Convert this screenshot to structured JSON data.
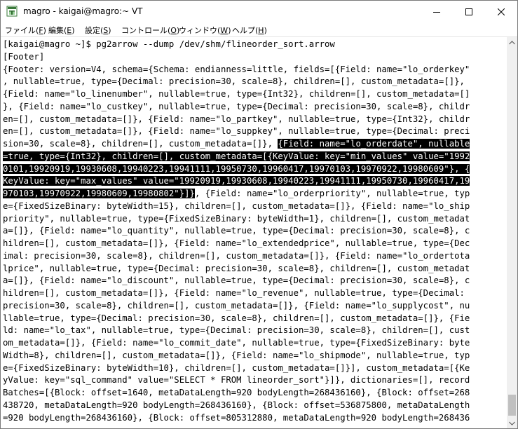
{
  "window": {
    "title": "magro - kaigai@magro:~ VT"
  },
  "menu": [
    {
      "label": "ファイル(",
      "key": "F",
      "end": ")"
    },
    {
      "label": "編集(",
      "key": "E",
      "end": ")"
    },
    {
      "label": "設定(",
      "key": "S",
      "end": ")"
    },
    {
      "label": "コントロール(",
      "key": "O",
      "end": ")"
    },
    {
      "label": "ウィンドウ(",
      "key": "W",
      "end": ")"
    },
    {
      "label": "ヘルプ(",
      "key": "H",
      "end": ")"
    }
  ],
  "terminal": {
    "lines": [
      {
        "a": "[kaigai@magro ~]$ pg2arrow --dump /dev/shm/flineorder_sort.arrow",
        "h": "",
        "b": ""
      },
      {
        "a": "[Footer]",
        "h": "",
        "b": ""
      },
      {
        "a": "{Footer: version=V4, schema={Schema: endianness=little, fields=[{Field: name=\"lo_orderkey\"",
        "h": "",
        "b": ""
      },
      {
        "a": ", nullable=true, type={Decimal: precision=30, scale=8}, children=[], custom_metadata=[]},",
        "h": "",
        "b": ""
      },
      {
        "a": "{Field: name=\"lo_linenumber\", nullable=true, type={Int32}, children=[], custom_metadata=[]",
        "h": "",
        "b": ""
      },
      {
        "a": "}, {Field: name=\"lo_custkey\", nullable=true, type={Decimal: precision=30, scale=8}, childr",
        "h": "",
        "b": ""
      },
      {
        "a": "en=[], custom_metadata=[]}, {Field: name=\"lo_partkey\", nullable=true, type={Int32}, childr",
        "h": "",
        "b": ""
      },
      {
        "a": "en=[], custom_metadata=[]}, {Field: name=\"lo_suppkey\", nullable=true, type={Decimal: preci",
        "h": "",
        "b": ""
      },
      {
        "a": "sion=30, scale=8}, children=[], custom_metadata=[]}, ",
        "h": "{Field: name=\"lo_orderdate\", nullable",
        "b": ""
      },
      {
        "a": "",
        "h": "=true, type={Int32}, children=[], custom_metadata=[{KeyValue: key=\"min_values\" value=\"1992",
        "b": ""
      },
      {
        "a": "",
        "h": "0101,19920919,19930608,19940223,19941111,19950730,19960417,19970103,19970922,19980609\"}, {",
        "b": ""
      },
      {
        "a": "",
        "h": "KeyValue: key=\"max_values\" value=\"19920919,19930608,19940223,19941111,19950730,19960417,19",
        "b": ""
      },
      {
        "a": "",
        "h": "970103,19970922,19980609,19980802\"}]}",
        "b": ", {Field: name=\"lo_orderpriority\", nullable=true, typ"
      },
      {
        "a": "e={FixedSizeBinary: byteWidth=15}, children=[], custom_metadata=[]}, {Field: name=\"lo_ship",
        "h": "",
        "b": ""
      },
      {
        "a": "priority\", nullable=true, type={FixedSizeBinary: byteWidth=1}, children=[], custom_metadat",
        "h": "",
        "b": ""
      },
      {
        "a": "a=[]}, {Field: name=\"lo_quantity\", nullable=true, type={Decimal: precision=30, scale=8}, c",
        "h": "",
        "b": ""
      },
      {
        "a": "hildren=[], custom_metadata=[]}, {Field: name=\"lo_extendedprice\", nullable=true, type={Dec",
        "h": "",
        "b": ""
      },
      {
        "a": "imal: precision=30, scale=8}, children=[], custom_metadata=[]}, {Field: name=\"lo_ordertota",
        "h": "",
        "b": ""
      },
      {
        "a": "lprice\", nullable=true, type={Decimal: precision=30, scale=8}, children=[], custom_metadat",
        "h": "",
        "b": ""
      },
      {
        "a": "a=[]}, {Field: name=\"lo_discount\", nullable=true, type={Decimal: precision=30, scale=8}, c",
        "h": "",
        "b": ""
      },
      {
        "a": "hildren=[], custom_metadata=[]}, {Field: name=\"lo_revenue\", nullable=true, type={Decimal:",
        "h": "",
        "b": ""
      },
      {
        "a": "precision=30, scale=8}, children=[], custom_metadata=[]}, {Field: name=\"lo_supplycost\", nu",
        "h": "",
        "b": ""
      },
      {
        "a": "llable=true, type={Decimal: precision=30, scale=8}, children=[], custom_metadata=[]}, {Fie",
        "h": "",
        "b": ""
      },
      {
        "a": "ld: name=\"lo_tax\", nullable=true, type={Decimal: precision=30, scale=8}, children=[], cust",
        "h": "",
        "b": ""
      },
      {
        "a": "om_metadata=[]}, {Field: name=\"lo_commit_date\", nullable=true, type={FixedSizeBinary: byte",
        "h": "",
        "b": ""
      },
      {
        "a": "Width=8}, children=[], custom_metadata=[]}, {Field: name=\"lo_shipmode\", nullable=true, typ",
        "h": "",
        "b": ""
      },
      {
        "a": "e={FixedSizeBinary: byteWidth=10}, children=[], custom_metadata=[]}], custom_metadata=[{Ke",
        "h": "",
        "b": ""
      },
      {
        "a": "yValue: key=\"sql_command\" value=\"SELECT * FROM lineorder_sort\"}]}, dictionaries=[], record",
        "h": "",
        "b": ""
      },
      {
        "a": "Batches=[{Block: offset=1640, metaDataLength=920 bodyLength=268436160}, {Block: offset=268",
        "h": "",
        "b": ""
      },
      {
        "a": "438720, metaDataLength=920 bodyLength=268436160}, {Block: offset=536875800, metaDataLength",
        "h": "",
        "b": ""
      },
      {
        "a": "=920 bodyLength=268436160}, {Block: offset=805312880, metaDataLength=920 bodyLength=268436",
        "h": "",
        "b": ""
      }
    ]
  }
}
